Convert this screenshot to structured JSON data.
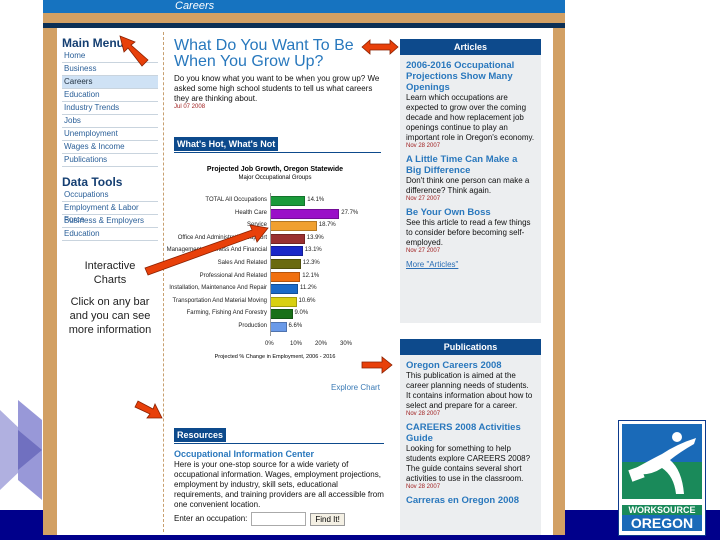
{
  "header": {
    "section": "Careers"
  },
  "sidebar": {
    "main_menu_title": "Main Menu",
    "main_menu": [
      "Home",
      "Business",
      "Careers",
      "Education",
      "Industry Trends",
      "Jobs",
      "Unemployment",
      "Wages & Income",
      "Publications"
    ],
    "selected": "Careers",
    "data_tools_title": "Data Tools",
    "data_tools": [
      "Occupations",
      "Employment & Labor Force",
      "Business & Employers",
      "Education"
    ]
  },
  "annotation": {
    "title": "Interactive Charts",
    "body": "Click on any bar and you can see more information"
  },
  "main": {
    "title": "What Do You Want To Be When You Grow Up?",
    "intro": "Do you know what you want to be when you grow up? We asked some high school students to tell us what careers they are thinking about.",
    "date": "Jul 07 2008",
    "hot_title": "What's Hot, What's Not",
    "explore": "Explore Chart",
    "resources_title": "Resources",
    "oic_title": "Occupational Information Center",
    "oic_text": "Here is your one-stop source for a wide variety of occupational information. Wages, employment projections, employment by industry, skill sets, educational requirements, and training providers are all accessible from one convenient location.",
    "occupation_label": "Enter an occupation:",
    "occupation_value": "",
    "find_button": "Find It!"
  },
  "chart_data": {
    "type": "bar",
    "orientation": "horizontal",
    "title": "Projected Job Growth, Oregon Statewide",
    "subtitle": "Major Occupational Groups",
    "xlabel": "Projected % Change in Employment, 2006 - 2016",
    "xlim": [
      0,
      30
    ],
    "xticks": [
      "0%",
      "10%",
      "20%",
      "30%"
    ],
    "categories": [
      "TOTAL All Occupations",
      "Health Care",
      "Service",
      "Office And Administrative Support",
      "Management, Business And Financial",
      "Sales And Related",
      "Professional And Related",
      "Installation, Maintenance And Repair",
      "Transportation And Material Moving",
      "Farming, Fishing And Forestry",
      "Production"
    ],
    "values": [
      14.1,
      27.7,
      18.7,
      13.9,
      13.1,
      12.3,
      12.1,
      11.2,
      10.6,
      9.0,
      6.6
    ],
    "labels": [
      "14.1%",
      "27.7%",
      "18.7%",
      "13.9%",
      "13.1%",
      "12.3%",
      "12.1%",
      "11.2%",
      "10.6%",
      "9.0%",
      "6.6%"
    ],
    "colors": [
      "#1a9a3a",
      "#9a10c8",
      "#f0a030",
      "#9a3030",
      "#1a28c8",
      "#6a6a10",
      "#f07010",
      "#1a6ac8",
      "#d8d010",
      "#187018",
      "#6a9ae8"
    ]
  },
  "articles": {
    "title": "Articles",
    "items": [
      {
        "title": "2006-2016 Occupational Projections Show Many Openings",
        "text": "Learn which occupations are expected to grow over the coming decade and how replacement job openings continue to play an important role in Oregon's economy.",
        "date": "Nov 28 2007"
      },
      {
        "title": "A Little Time Can Make a Big Difference",
        "text": "Don't think one person can make a difference? Think again.",
        "date": "Nov 27 2007"
      },
      {
        "title": "Be Your Own Boss",
        "text": "See this article to read a few things to consider before becoming self-employed.",
        "date": "Nov 27 2007"
      }
    ],
    "more": "More \"Articles\""
  },
  "publications": {
    "title": "Publications",
    "items": [
      {
        "title": "Oregon Careers 2008",
        "text": "This publication is aimed at the career planning needs of students. It contains information about how to select and prepare for a career.",
        "date": "Nov 28 2007"
      },
      {
        "title": "CAREERS 2008 Activities Guide",
        "text": "Looking for something to help students explore CAREERS 2008? The guide contains several short activities to use in the classroom.",
        "date": "Nov 28 2007"
      },
      {
        "title": "Carreras en Oregon 2008",
        "text": "",
        "date": ""
      }
    ]
  },
  "logo": {
    "line1": "WORKSOURCE",
    "line2": "OREGON"
  },
  "colors": {
    "accent_blue": "#0d4a8c",
    "arrow": "#e8400a",
    "tan": "#d2a064",
    "slide_navy": "#00008b"
  }
}
